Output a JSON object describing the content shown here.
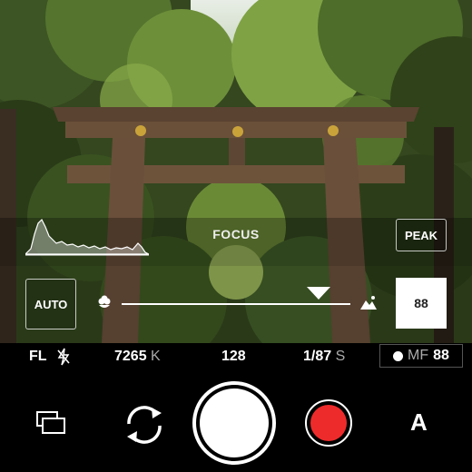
{
  "viewfinder": {
    "description_colors": {
      "sky": "#dfe8e0",
      "foliage_dark": "#2b3a1f",
      "foliage_mid": "#4f6b2c",
      "foliage_light": "#8fae4e",
      "torii_wood": "#5e4634",
      "torii_medallion": "#c9a33a"
    }
  },
  "overlay": {
    "focus_label": "FOCUS",
    "peak_label": "PEAK",
    "auto_label": "AUTO",
    "focus_value": "88",
    "slider_position": 0.86
  },
  "status_bar": {
    "flash_label": "FL",
    "flash_icon": "flash-off-icon",
    "white_balance_value": "7265",
    "white_balance_unit": "K",
    "iso_value": "128",
    "shutter_value": "1/87",
    "shutter_unit": "S",
    "focus_mode": "MF",
    "focus_mode_value": "88"
  },
  "controls": {
    "gallery_icon": "gallery-icon",
    "flip_icon": "flip-camera-icon",
    "record_color": "#ee2b2b",
    "mode_letter": "A"
  }
}
